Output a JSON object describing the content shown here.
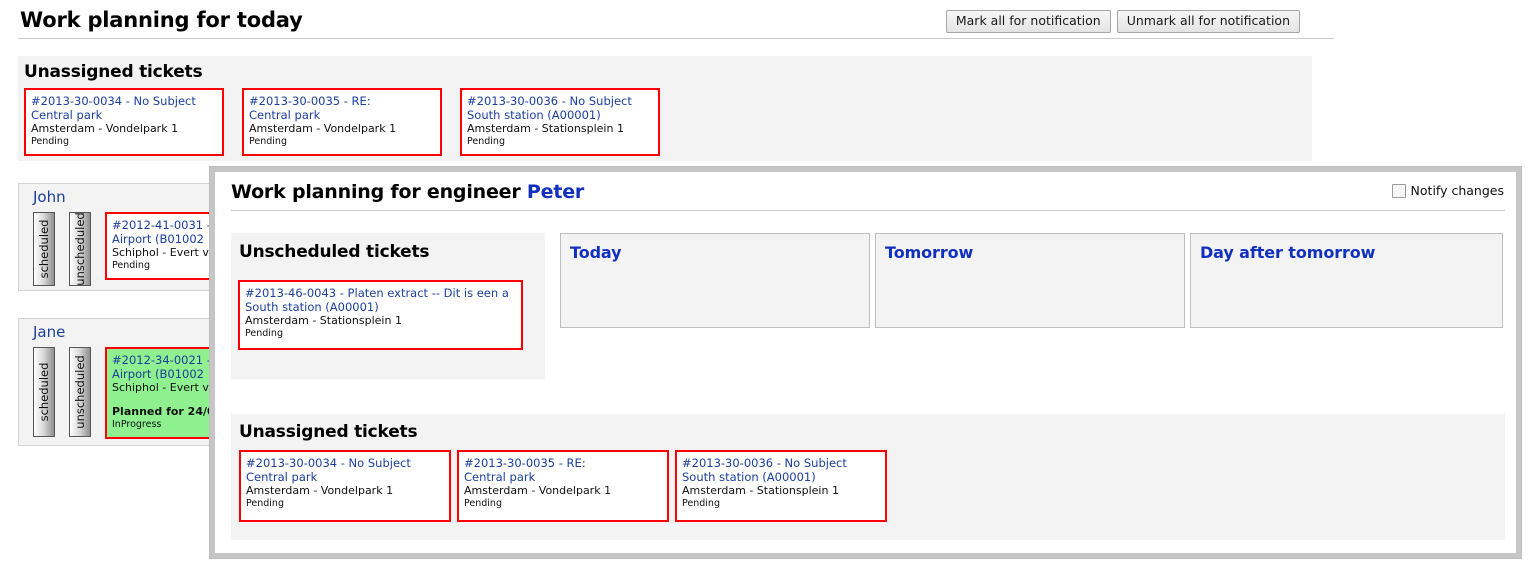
{
  "page": {
    "title": "Work planning for today",
    "buttons": [
      {
        "label": "Mark all for notification",
        "name": "mark-all-notification-button"
      },
      {
        "label": "Unmark all for notification",
        "name": "unmark-all-notification-button"
      }
    ],
    "unassigned_heading": "Unassigned tickets",
    "unassigned_tickets": [
      {
        "line1": "#2013-30-0034 - No Subject",
        "line2": "Central park",
        "line3": "Amsterdam - Vondelpark 1",
        "status": "Pending"
      },
      {
        "line1": "#2013-30-0035 - RE:",
        "line2": "Central park",
        "line3": "Amsterdam - Vondelpark 1",
        "status": "Pending"
      },
      {
        "line1": "#2013-30-0036 - No Subject",
        "line2": "South station (A00001)",
        "line3": "Amsterdam - Stationsplein 1",
        "status": "Pending"
      }
    ],
    "engineers": [
      {
        "name": "John",
        "tab_scheduled": "scheduled",
        "tab_unscheduled": "unscheduled",
        "ticket": {
          "line1": "#2012-41-0031 -",
          "line2": "Airport (B01002",
          "line3": "Schiphol - Evert v",
          "status": "Pending",
          "planned": "",
          "highlight": false
        }
      },
      {
        "name": "Jane",
        "tab_scheduled": "scheduled",
        "tab_unscheduled": "unscheduled",
        "ticket": {
          "line1": "#2012-34-0021 -",
          "line2": "Airport (B01002",
          "line3": "Schiphol - Evert v",
          "planned": "Planned for 24/0",
          "status": "InProgress",
          "highlight": true
        }
      }
    ]
  },
  "modal": {
    "title_prefix": "Work planning for engineer ",
    "engineer_name": "Peter",
    "notify_label": "Notify changes",
    "notify_checked": false,
    "unscheduled_heading": "Unscheduled tickets",
    "unscheduled_tickets": [
      {
        "line1": "#2013-46-0043 - Platen extract -- Dit is een a",
        "line2": "South station (A00001)",
        "line3": "Amsterdam - Stationsplein 1",
        "status": "Pending"
      }
    ],
    "day_columns": [
      {
        "label": "Today",
        "name": "day-column-today"
      },
      {
        "label": "Tomorrow",
        "name": "day-column-tomorrow"
      },
      {
        "label": "Day after tomorrow",
        "name": "day-column-day-after-tomorrow"
      }
    ],
    "unassigned_heading": "Unassigned tickets",
    "unassigned_tickets": [
      {
        "line1": "#2013-30-0034 - No Subject",
        "line2": "Central park",
        "line3": "Amsterdam - Vondelpark 1",
        "status": "Pending"
      },
      {
        "line1": "#2013-30-0035 - RE:",
        "line2": "Central park",
        "line3": "Amsterdam - Vondelpark 1",
        "status": "Pending"
      },
      {
        "line1": "#2013-30-0036 - No Subject",
        "line2": "South station (A00001)",
        "line3": "Amsterdam - Stationsplein 1",
        "status": "Pending"
      }
    ]
  },
  "colors": {
    "ticket_border": "#ff0000",
    "link_blue": "#1b3f9c",
    "heading_blue": "#1130c0",
    "panel_grey": "#f3f3f3",
    "highlight_green": "#8ef08e"
  }
}
